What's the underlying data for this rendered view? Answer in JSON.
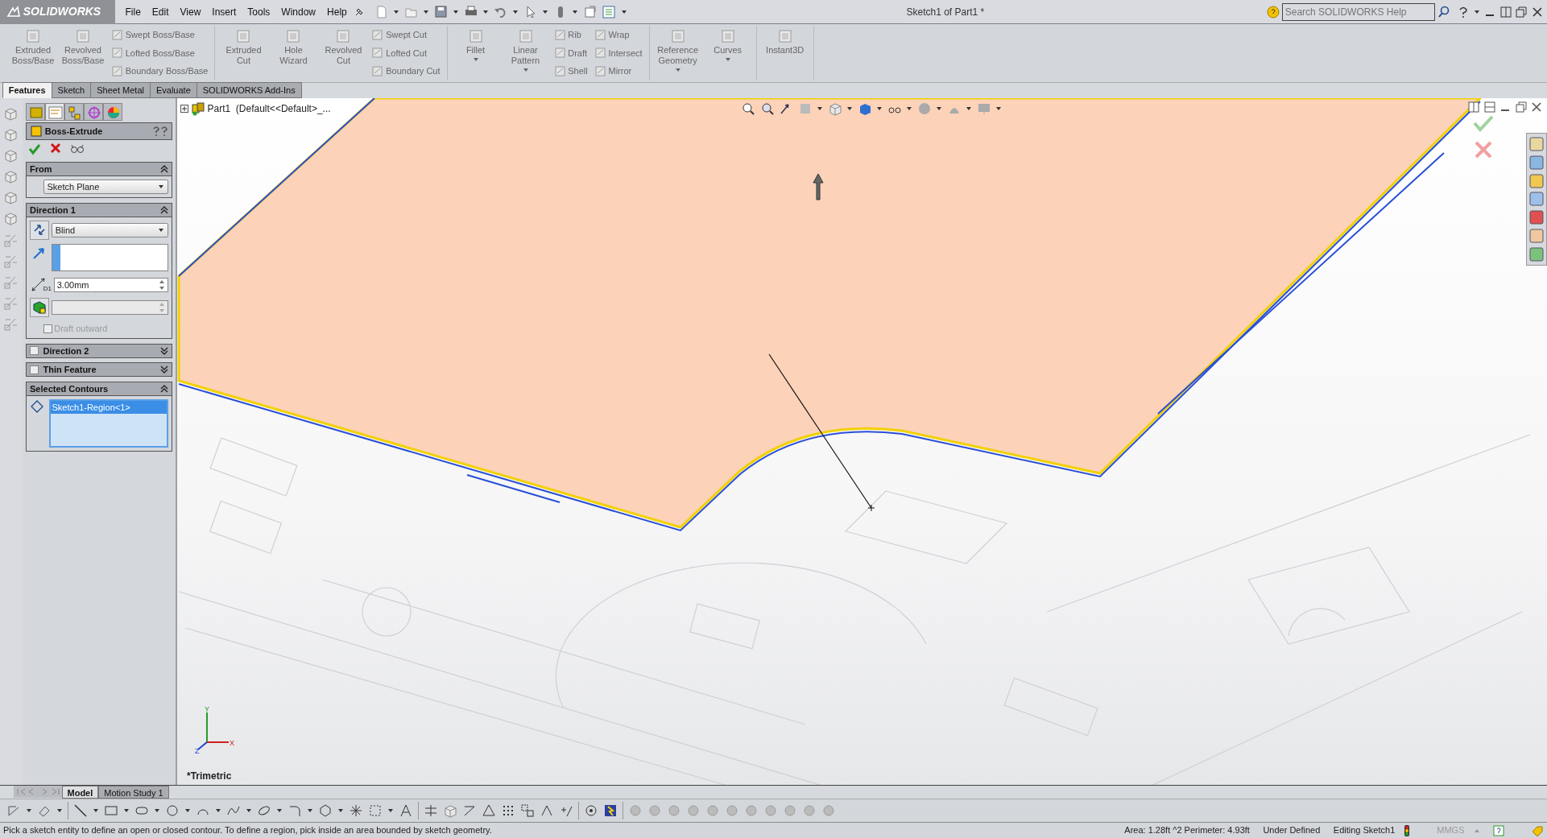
{
  "title_bar": {
    "app_name": "SOLIDWORKS",
    "menus": [
      "File",
      "Edit",
      "View",
      "Insert",
      "Tools",
      "Window",
      "Help"
    ],
    "document_title": "Sketch1 of Part1 *",
    "search": {
      "placeholder": "Search SOLIDWORKS Help"
    }
  },
  "ribbon": {
    "groups": [
      {
        "items": [
          {
            "kind": "large",
            "label": "Extruded Boss/Base",
            "dropdown": false
          },
          {
            "kind": "large",
            "label": "Revolved Boss/Base",
            "dropdown": false
          },
          {
            "kind": "stack",
            "labels": [
              "Swept Boss/Base",
              "Lofted Boss/Base",
              "Boundary Boss/Base"
            ]
          }
        ]
      },
      {
        "items": [
          {
            "kind": "large",
            "label": "Extruded Cut",
            "dropdown": false
          },
          {
            "kind": "large",
            "label": "Hole Wizard",
            "dropdown": false
          },
          {
            "kind": "large",
            "label": "Revolved Cut",
            "dropdown": false
          },
          {
            "kind": "stack",
            "labels": [
              "Swept Cut",
              "Lofted Cut",
              "Boundary Cut"
            ]
          }
        ]
      },
      {
        "items": [
          {
            "kind": "large",
            "label": "Fillet",
            "dropdown": true
          },
          {
            "kind": "large",
            "label": "Linear Pattern",
            "dropdown": true
          },
          {
            "kind": "stack",
            "labels": [
              "Rib",
              "Draft",
              "Shell"
            ]
          },
          {
            "kind": "stack",
            "labels": [
              "Wrap",
              "Intersect",
              "Mirror"
            ]
          }
        ]
      },
      {
        "items": [
          {
            "kind": "large",
            "label": "Reference Geometry",
            "dropdown": true
          },
          {
            "kind": "large",
            "label": "Curves",
            "dropdown": true
          }
        ]
      },
      {
        "items": [
          {
            "kind": "large",
            "label": "Instant3D",
            "dropdown": false
          }
        ]
      }
    ]
  },
  "command_tabs": [
    {
      "label": "Features",
      "selected": true
    },
    {
      "label": "Sketch",
      "selected": false
    },
    {
      "label": "Sheet Metal",
      "selected": false
    },
    {
      "label": "Evaluate",
      "selected": false
    },
    {
      "label": "SOLIDWORKS Add-Ins",
      "selected": false
    }
  ],
  "manager_tabs": [
    {
      "selected": false
    },
    {
      "selected": true
    },
    {
      "selected": false
    },
    {
      "selected": false
    },
    {
      "selected": false
    }
  ],
  "property_manager": {
    "title": "Boss-Extrude",
    "from": {
      "title": "From",
      "expanded": true,
      "value": "Sketch Plane"
    },
    "direction_1": {
      "title": "Direction 1",
      "expanded": true,
      "end_condition": "Blind",
      "depth": "3.00mm",
      "dimension_symbol": "D1",
      "draft_outward": {
        "label": "Draft outward",
        "checked": false,
        "disabled": true
      }
    },
    "direction_2": {
      "title": "Direction 2",
      "checked": false,
      "expanded": false
    },
    "thin_feature": {
      "title": "Thin Feature",
      "checked": false,
      "expanded": false
    },
    "selected_contours": {
      "title": "Selected Contours",
      "expanded": true,
      "items": [
        {
          "label": "Sketch1-Region<1>",
          "selected": true
        }
      ]
    }
  },
  "feature_tree": {
    "root": "Part1  (Default<<Default>_..."
  },
  "viewport": {
    "view_name": "*Trimetric",
    "triad_labels": [
      "Y",
      "X",
      "Z"
    ]
  },
  "bottom_tabs": [
    {
      "label": "Model",
      "selected": true
    },
    {
      "label": "Motion Study 1",
      "selected": false
    }
  ],
  "status_bar": {
    "message": "Pick a sketch entity to define an open or closed contour. To define a region, pick inside an area bounded by sketch geometry.",
    "measure": "Area: 1.28ft ^2 Perimeter: 4.93ft",
    "sketch_state": "Under Defined",
    "mode": "Editing Sketch1",
    "units": "MMGS"
  }
}
